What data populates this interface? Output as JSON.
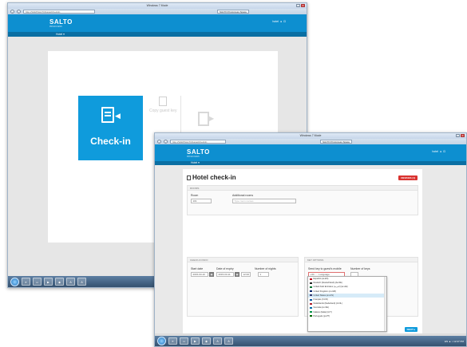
{
  "back_window": {
    "title": "Windows 7 Mode",
    "address": "http://SAM/SALTO/HotelCheckIn",
    "tab": "SALTO ProAccess Space",
    "app": {
      "logo": "SALTO",
      "logo_sub": "PROACCESS",
      "user": "hotel",
      "subnav": "Hotel ▾"
    },
    "tiles": {
      "checkin": "Check-in",
      "copy_key": "Copy guest key"
    }
  },
  "front_window": {
    "title": "Windows 7 Mode",
    "address": "http://SAM/SALTO/HotelCheckIn",
    "tab": "SALTO ProAccess Space",
    "app": {
      "logo": "SALTO",
      "logo_sub": "PROACCESS",
      "user": "hotel",
      "subnav": "Hotel ▾"
    },
    "page_title": "Hotel check-in",
    "devices_button": "DEVICES (1)",
    "rooms_section": {
      "header": "ROOMS",
      "room_label": "Room",
      "room_value": "101",
      "additional_label": "Additional rooms",
      "additional_placeholder": "Type room names"
    },
    "checkin_section": {
      "header": "CHECK-IN INFO",
      "start_label": "Start date",
      "start_value": "2015-03-10",
      "expiry_label": "Date of expiry",
      "expiry_value": "2015-03-11",
      "time_value": "12:00",
      "nights_label": "Number of nights",
      "nights_value": "1"
    },
    "key_section": {
      "header": "KEY OPTIONS",
      "send_label": "Send key to guest's mobile",
      "send_value": "+34 ..... Language",
      "num_keys_label": "Number of keys",
      "languages": [
        {
          "name": "Español (es-ES)",
          "flag": "#c60b1e"
        },
        {
          "name": "Deutsch (Deutschland) (de-DE)",
          "flag": "#222222"
        },
        {
          "name": "United Arab Emirates (العربية) (ar-AE)",
          "flag": "#00732f"
        },
        {
          "name": "United Kingdom (en-GB)",
          "flag": "#012169"
        },
        {
          "name": "United States (en-US)",
          "flag": "#3c3b6e"
        },
        {
          "name": "Français (fr-FR)",
          "flag": "#0055a4"
        },
        {
          "name": "Nederlands (Nederland) (nl-NL)",
          "flag": "#ae1c28"
        },
        {
          "name": "Svenska (sv-SE)",
          "flag": "#006aa7"
        },
        {
          "name": "Italiano (Italia) (it-IT)",
          "flag": "#009246"
        },
        {
          "name": "Português (pt-PT)",
          "flag": "#006600"
        }
      ]
    },
    "next_button": "NEXT ▸"
  },
  "taskbar": {
    "tray": "EN  ▲  ♪  12:47 PM"
  }
}
